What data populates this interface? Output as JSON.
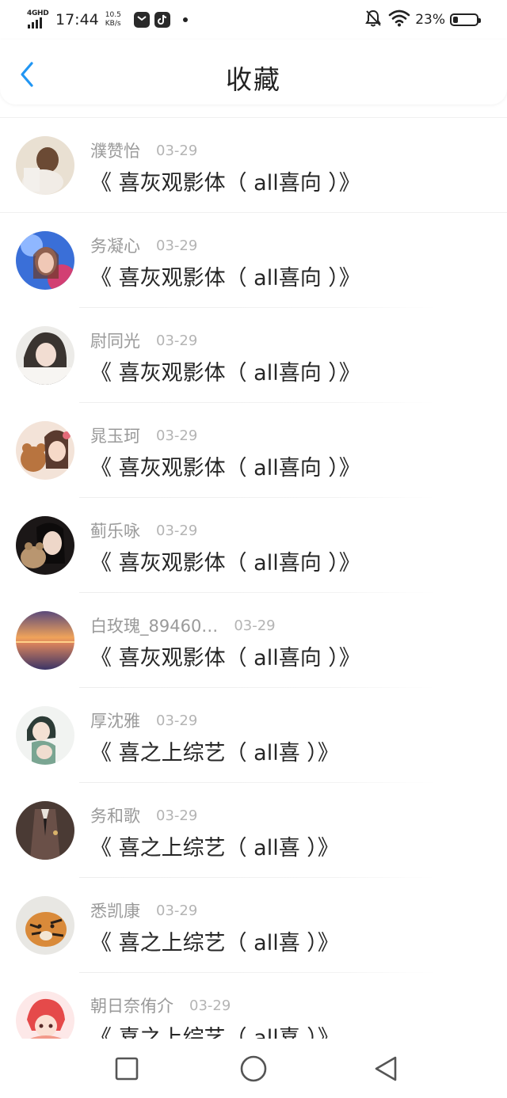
{
  "status_bar": {
    "network": "4GHD",
    "time": "17:44",
    "speed_value": "10.5",
    "speed_unit": "KB/s",
    "app_icons": [
      "message-icon",
      "tiktok-icon"
    ],
    "battery": "23%",
    "battery_level": 0.23
  },
  "header": {
    "title": "收藏",
    "back_icon": "chevron-left-icon",
    "accent": "#2196f3"
  },
  "favorites": [
    {
      "user": "濮赞怡",
      "date": "03-29",
      "title": "《 喜灰观影体（ all喜向 ）》"
    },
    {
      "user": "务凝心",
      "date": "03-29",
      "title": "《 喜灰观影体（ all喜向 ）》"
    },
    {
      "user": "尉同光",
      "date": "03-29",
      "title": "《 喜灰观影体（ all喜向 ）》"
    },
    {
      "user": "晁玉珂",
      "date": "03-29",
      "title": "《 喜灰观影体（ all喜向 ）》"
    },
    {
      "user": "蓟乐咏",
      "date": "03-29",
      "title": "《 喜灰观影体（ all喜向 ）》"
    },
    {
      "user": "白玫瑰_89460…",
      "date": "03-29",
      "title": "《 喜灰观影体（ all喜向 ）》"
    },
    {
      "user": "厚沈雅",
      "date": "03-29",
      "title": "《 喜之上综艺（ all喜 ）》"
    },
    {
      "user": "务和歌",
      "date": "03-29",
      "title": "《 喜之上综艺（ all喜 ）》"
    },
    {
      "user": "悉凯康",
      "date": "03-29",
      "title": "《 喜之上综艺（ all喜 ）》"
    },
    {
      "user": "朝日奈侑介",
      "date": "03-29",
      "title": "《 喜之上综艺（ all喜 ）》"
    }
  ],
  "nav_bar": {
    "icons": [
      "recents-square-icon",
      "home-circle-icon",
      "back-triangle-icon"
    ]
  }
}
